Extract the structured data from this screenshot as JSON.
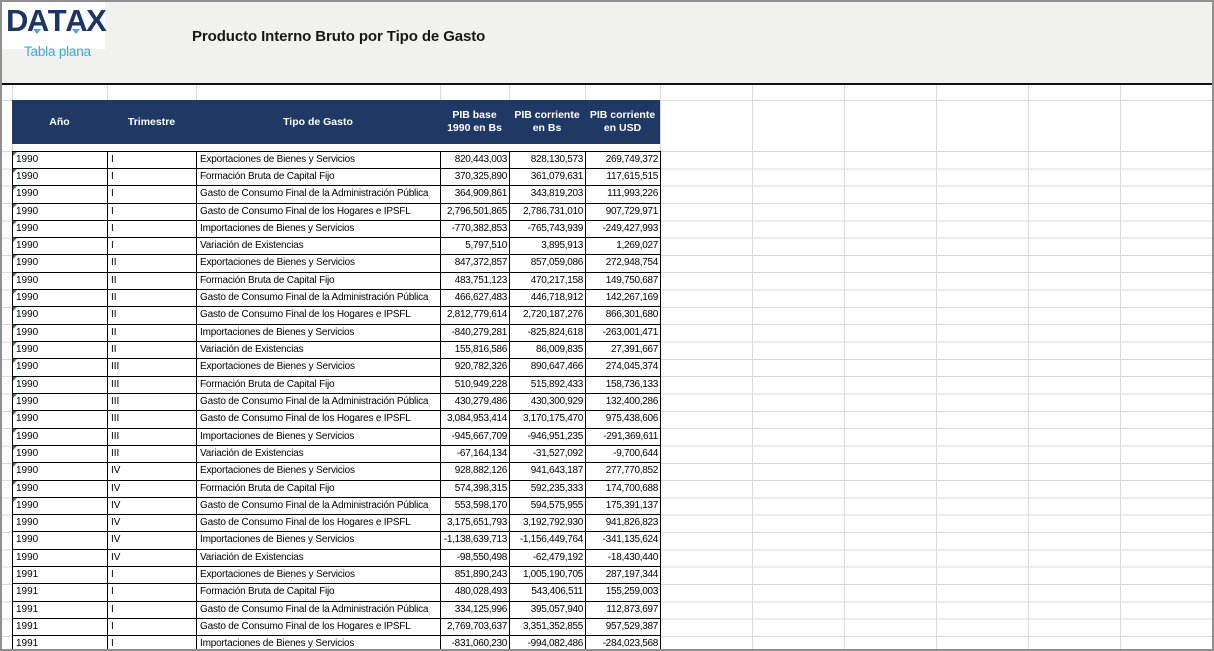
{
  "logo": {
    "brand": "DATAX",
    "subtitle": "Tabla plana"
  },
  "title": "Producto Interno Bruto por Tipo de Gasto",
  "colors": {
    "header_bg": "#1f3864",
    "brand_navy": "#1c3566",
    "brand_blue": "#3fa9dc",
    "flag_green": "#1e8e3e",
    "banner_bg": "#f1f1f0",
    "gridline": "#d9d9d9"
  },
  "table": {
    "columns": [
      {
        "line1": "Año",
        "line2": ""
      },
      {
        "line1": "Trimestre",
        "line2": ""
      },
      {
        "line1": "Tipo de Gasto",
        "line2": ""
      },
      {
        "line1": "PIB base",
        "line2": "1990 en Bs"
      },
      {
        "line1": "PIB corriente",
        "line2": "en Bs"
      },
      {
        "line1": "PIB corriente",
        "line2": "en USD"
      }
    ],
    "rows": [
      {
        "year": "1990",
        "quarter": "I",
        "tipo": "Exportaciones de Bienes y Servicios",
        "base": "820,443,003",
        "bs": "828,130,573",
        "usd": "269,749,372",
        "flag": true
      },
      {
        "year": "1990",
        "quarter": "I",
        "tipo": "Formación Bruta de Capital Fijo",
        "base": "370,325,890",
        "bs": "361,079,631",
        "usd": "117,615,515",
        "flag": true
      },
      {
        "year": "1990",
        "quarter": "I",
        "tipo": "Gasto de Consumo Final de la Administración Pública",
        "base": "364,909,861",
        "bs": "343,819,203",
        "usd": "111,993,226",
        "flag": true
      },
      {
        "year": "1990",
        "quarter": "I",
        "tipo": "Gasto de Consumo Final de los Hogares e IPSFL",
        "base": "2,796,501,865",
        "bs": "2,786,731,010",
        "usd": "907,729,971",
        "flag": true
      },
      {
        "year": "1990",
        "quarter": "I",
        "tipo": "Importaciones de Bienes y Servicios",
        "base": "-770,382,853",
        "bs": "-765,743,939",
        "usd": "-249,427,993",
        "flag": true
      },
      {
        "year": "1990",
        "quarter": "I",
        "tipo": "Variación de Existencias",
        "base": "5,797,510",
        "bs": "3,895,913",
        "usd": "1,269,027",
        "flag": true
      },
      {
        "year": "1990",
        "quarter": "II",
        "tipo": "Exportaciones de Bienes y Servicios",
        "base": "847,372,857",
        "bs": "857,059,086",
        "usd": "272,948,754",
        "flag": true
      },
      {
        "year": "1990",
        "quarter": "II",
        "tipo": "Formación Bruta de Capital Fijo",
        "base": "483,751,123",
        "bs": "470,217,158",
        "usd": "149,750,687",
        "flag": true
      },
      {
        "year": "1990",
        "quarter": "II",
        "tipo": "Gasto de Consumo Final de la Administración Pública",
        "base": "466,627,483",
        "bs": "446,718,912",
        "usd": "142,267,169",
        "flag": true
      },
      {
        "year": "1990",
        "quarter": "II",
        "tipo": "Gasto de Consumo Final de los Hogares e IPSFL",
        "base": "2,812,779,614",
        "bs": "2,720,187,276",
        "usd": "866,301,680",
        "flag": true
      },
      {
        "year": "1990",
        "quarter": "II",
        "tipo": "Importaciones de Bienes y Servicios",
        "base": "-840,279,281",
        "bs": "-825,824,618",
        "usd": "-263,001,471",
        "flag": true
      },
      {
        "year": "1990",
        "quarter": "II",
        "tipo": "Variación de Existencias",
        "base": "155,816,586",
        "bs": "86,009,835",
        "usd": "27,391,667",
        "flag": true
      },
      {
        "year": "1990",
        "quarter": "III",
        "tipo": "Exportaciones de Bienes y Servicios",
        "base": "920,782,326",
        "bs": "890,647,466",
        "usd": "274,045,374",
        "flag": true
      },
      {
        "year": "1990",
        "quarter": "III",
        "tipo": "Formación Bruta de Capital Fijo",
        "base": "510,949,228",
        "bs": "515,892,433",
        "usd": "158,736,133",
        "flag": true
      },
      {
        "year": "1990",
        "quarter": "III",
        "tipo": "Gasto de Consumo Final de la Administración Pública",
        "base": "430,279,486",
        "bs": "430,300,929",
        "usd": "132,400,286",
        "flag": true
      },
      {
        "year": "1990",
        "quarter": "III",
        "tipo": "Gasto de Consumo Final de los Hogares e IPSFL",
        "base": "3,084,953,414",
        "bs": "3,170,175,470",
        "usd": "975,438,606",
        "flag": true
      },
      {
        "year": "1990",
        "quarter": "III",
        "tipo": "Importaciones de Bienes y Servicios",
        "base": "-945,667,709",
        "bs": "-946,951,235",
        "usd": "-291,369,611",
        "flag": true
      },
      {
        "year": "1990",
        "quarter": "III",
        "tipo": "Variación de Existencias",
        "base": "-67,164,134",
        "bs": "-31,527,092",
        "usd": "-9,700,644",
        "flag": true
      },
      {
        "year": "1990",
        "quarter": "IV",
        "tipo": "Exportaciones de Bienes y Servicios",
        "base": "928,882,126",
        "bs": "941,643,187",
        "usd": "277,770,852",
        "flag": true
      },
      {
        "year": "1990",
        "quarter": "IV",
        "tipo": "Formación Bruta de Capital Fijo",
        "base": "574,398,315",
        "bs": "592,235,333",
        "usd": "174,700,688",
        "flag": true
      },
      {
        "year": "1990",
        "quarter": "IV",
        "tipo": "Gasto de Consumo Final de la Administración Pública",
        "base": "553,598,170",
        "bs": "594,575,955",
        "usd": "175,391,137",
        "flag": true
      },
      {
        "year": "1990",
        "quarter": "IV",
        "tipo": "Gasto de Consumo Final de los Hogares e IPSFL",
        "base": "3,175,651,793",
        "bs": "3,192,792,930",
        "usd": "941,826,823",
        "flag": false
      },
      {
        "year": "1990",
        "quarter": "IV",
        "tipo": "Importaciones de Bienes y Servicios",
        "base": "-1,138,639,713",
        "bs": "-1,156,449,764",
        "usd": "-341,135,624",
        "flag": false
      },
      {
        "year": "1990",
        "quarter": "IV",
        "tipo": "Variación de Existencias",
        "base": "-98,550,498",
        "bs": "-62,479,192",
        "usd": "-18,430,440",
        "flag": false
      },
      {
        "year": "1991",
        "quarter": "I",
        "tipo": "Exportaciones de Bienes y Servicios",
        "base": "851,890,243",
        "bs": "1,005,190,705",
        "usd": "287,197,344",
        "flag": false
      },
      {
        "year": "1991",
        "quarter": "I",
        "tipo": "Formación Bruta de Capital Fijo",
        "base": "480,028,493",
        "bs": "543,406,511",
        "usd": "155,259,003",
        "flag": false
      },
      {
        "year": "1991",
        "quarter": "I",
        "tipo": "Gasto de Consumo Final de la Administración Pública",
        "base": "334,125,996",
        "bs": "395,057,940",
        "usd": "112,873,697",
        "flag": false
      },
      {
        "year": "1991",
        "quarter": "I",
        "tipo": "Gasto de Consumo Final de los Hogares e IPSFL",
        "base": "2,769,703,637",
        "bs": "3,351,352,855",
        "usd": "957,529,387",
        "flag": false
      },
      {
        "year": "1991",
        "quarter": "I",
        "tipo": "Importaciones de Bienes y Servicios",
        "base": "-831,060,230",
        "bs": "-994,082,486",
        "usd": "-284,023,568",
        "flag": false
      }
    ]
  }
}
